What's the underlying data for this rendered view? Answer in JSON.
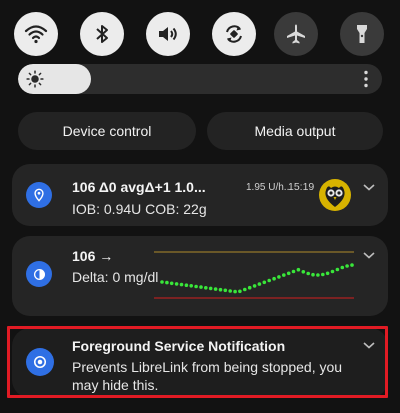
{
  "quick_settings": {
    "toggles": [
      {
        "name": "wifi",
        "state": "on"
      },
      {
        "name": "bluetooth",
        "state": "on"
      },
      {
        "name": "sound",
        "state": "on"
      },
      {
        "name": "auto-rotate",
        "state": "on"
      },
      {
        "name": "airplane-mode",
        "state": "off"
      },
      {
        "name": "flashlight",
        "state": "off"
      }
    ],
    "brightness_level": 0.2,
    "device_control_label": "Device control",
    "media_output_label": "Media output"
  },
  "notifications": {
    "aaps": {
      "title": "106  Δ0 avgΔ+1  1.0...",
      "basal": "1.95 U/h...",
      "time": "15:19",
      "detail": "IOB: 0.94U COB: 22g"
    },
    "graph": {
      "title": "106 →",
      "detail": "Delta: 0 mg/dl"
    },
    "foreground": {
      "title": "Foreground Service Notification",
      "body_line1": "Prevents LibreLink from being stopped, you",
      "body_line2": "may hide this."
    }
  },
  "colors": {
    "accent_blue": "#2f6fe4",
    "graph_dots": "#39e63a",
    "high_line": "#b08a2a",
    "low_line": "#d21f1f",
    "highlight_border": "#e11b24"
  }
}
